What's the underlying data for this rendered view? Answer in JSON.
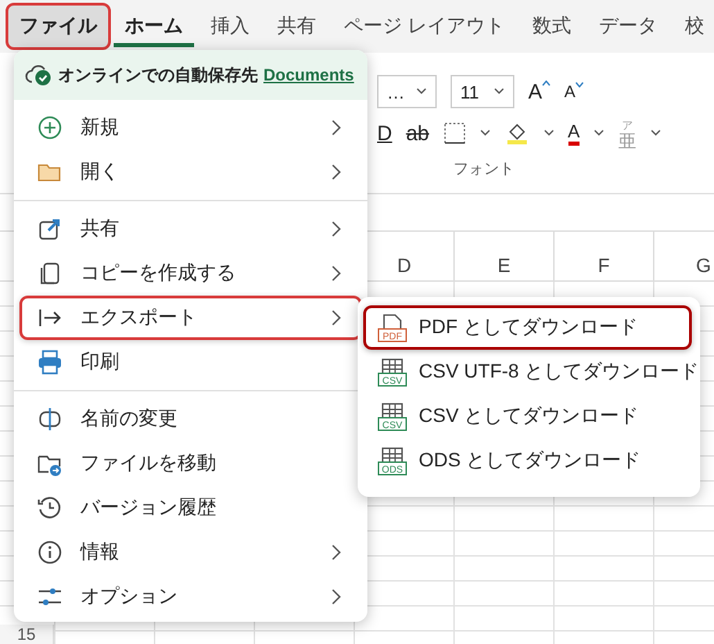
{
  "tabs": [
    {
      "label": "ファイル",
      "selected": false,
      "highlighted": true
    },
    {
      "label": "ホーム",
      "selected": true,
      "highlighted": false
    },
    {
      "label": "挿入",
      "selected": false,
      "highlighted": false
    },
    {
      "label": "共有",
      "selected": false,
      "highlighted": false
    },
    {
      "label": "ページ レイアウト",
      "selected": false,
      "highlighted": false
    },
    {
      "label": "数式",
      "selected": false,
      "highlighted": false
    },
    {
      "label": "データ",
      "selected": false,
      "highlighted": false
    },
    {
      "label": "校",
      "selected": false,
      "highlighted": false
    }
  ],
  "ribbon": {
    "font_name": "…",
    "font_size": "11",
    "grow_label": "A",
    "shrink_label": "A",
    "underline_label": "D",
    "strike_label": "ab",
    "font_color_label": "A",
    "phonetic_label": "亜",
    "phonetic_ruby": "ア",
    "group_label": "フォント"
  },
  "grid": {
    "columns": [
      "D",
      "E",
      "F",
      "G"
    ],
    "row_number": "15"
  },
  "file_menu": {
    "autosave": {
      "text": "オンラインでの自動保存先",
      "link": "Documents"
    },
    "groups": [
      [
        {
          "label": "新規",
          "submenu": true,
          "highlighted": false
        },
        {
          "label": "開く",
          "submenu": true,
          "highlighted": false
        }
      ],
      [
        {
          "label": "共有",
          "submenu": true,
          "highlighted": false
        },
        {
          "label": "コピーを作成する",
          "submenu": true,
          "highlighted": false
        },
        {
          "label": "エクスポート",
          "submenu": true,
          "highlighted": true
        },
        {
          "label": "印刷",
          "submenu": false,
          "highlighted": false
        }
      ],
      [
        {
          "label": "名前の変更",
          "submenu": false,
          "highlighted": false
        },
        {
          "label": "ファイルを移動",
          "submenu": false,
          "highlighted": false
        },
        {
          "label": "バージョン履歴",
          "submenu": false,
          "highlighted": false
        },
        {
          "label": "情報",
          "submenu": true,
          "highlighted": false
        },
        {
          "label": "オプション",
          "submenu": true,
          "highlighted": false
        }
      ]
    ]
  },
  "export_menu": [
    {
      "label": "PDF としてダウンロード",
      "badge": "PDF",
      "kind": "pdf",
      "highlighted": true
    },
    {
      "label": "CSV UTF-8 としてダウンロード",
      "badge": "CSV",
      "kind": "table",
      "highlighted": false
    },
    {
      "label": "CSV としてダウンロード",
      "badge": "CSV",
      "kind": "table",
      "highlighted": false
    },
    {
      "label": "ODS としてダウンロード",
      "badge": "ODS",
      "kind": "table",
      "highlighted": false
    }
  ]
}
